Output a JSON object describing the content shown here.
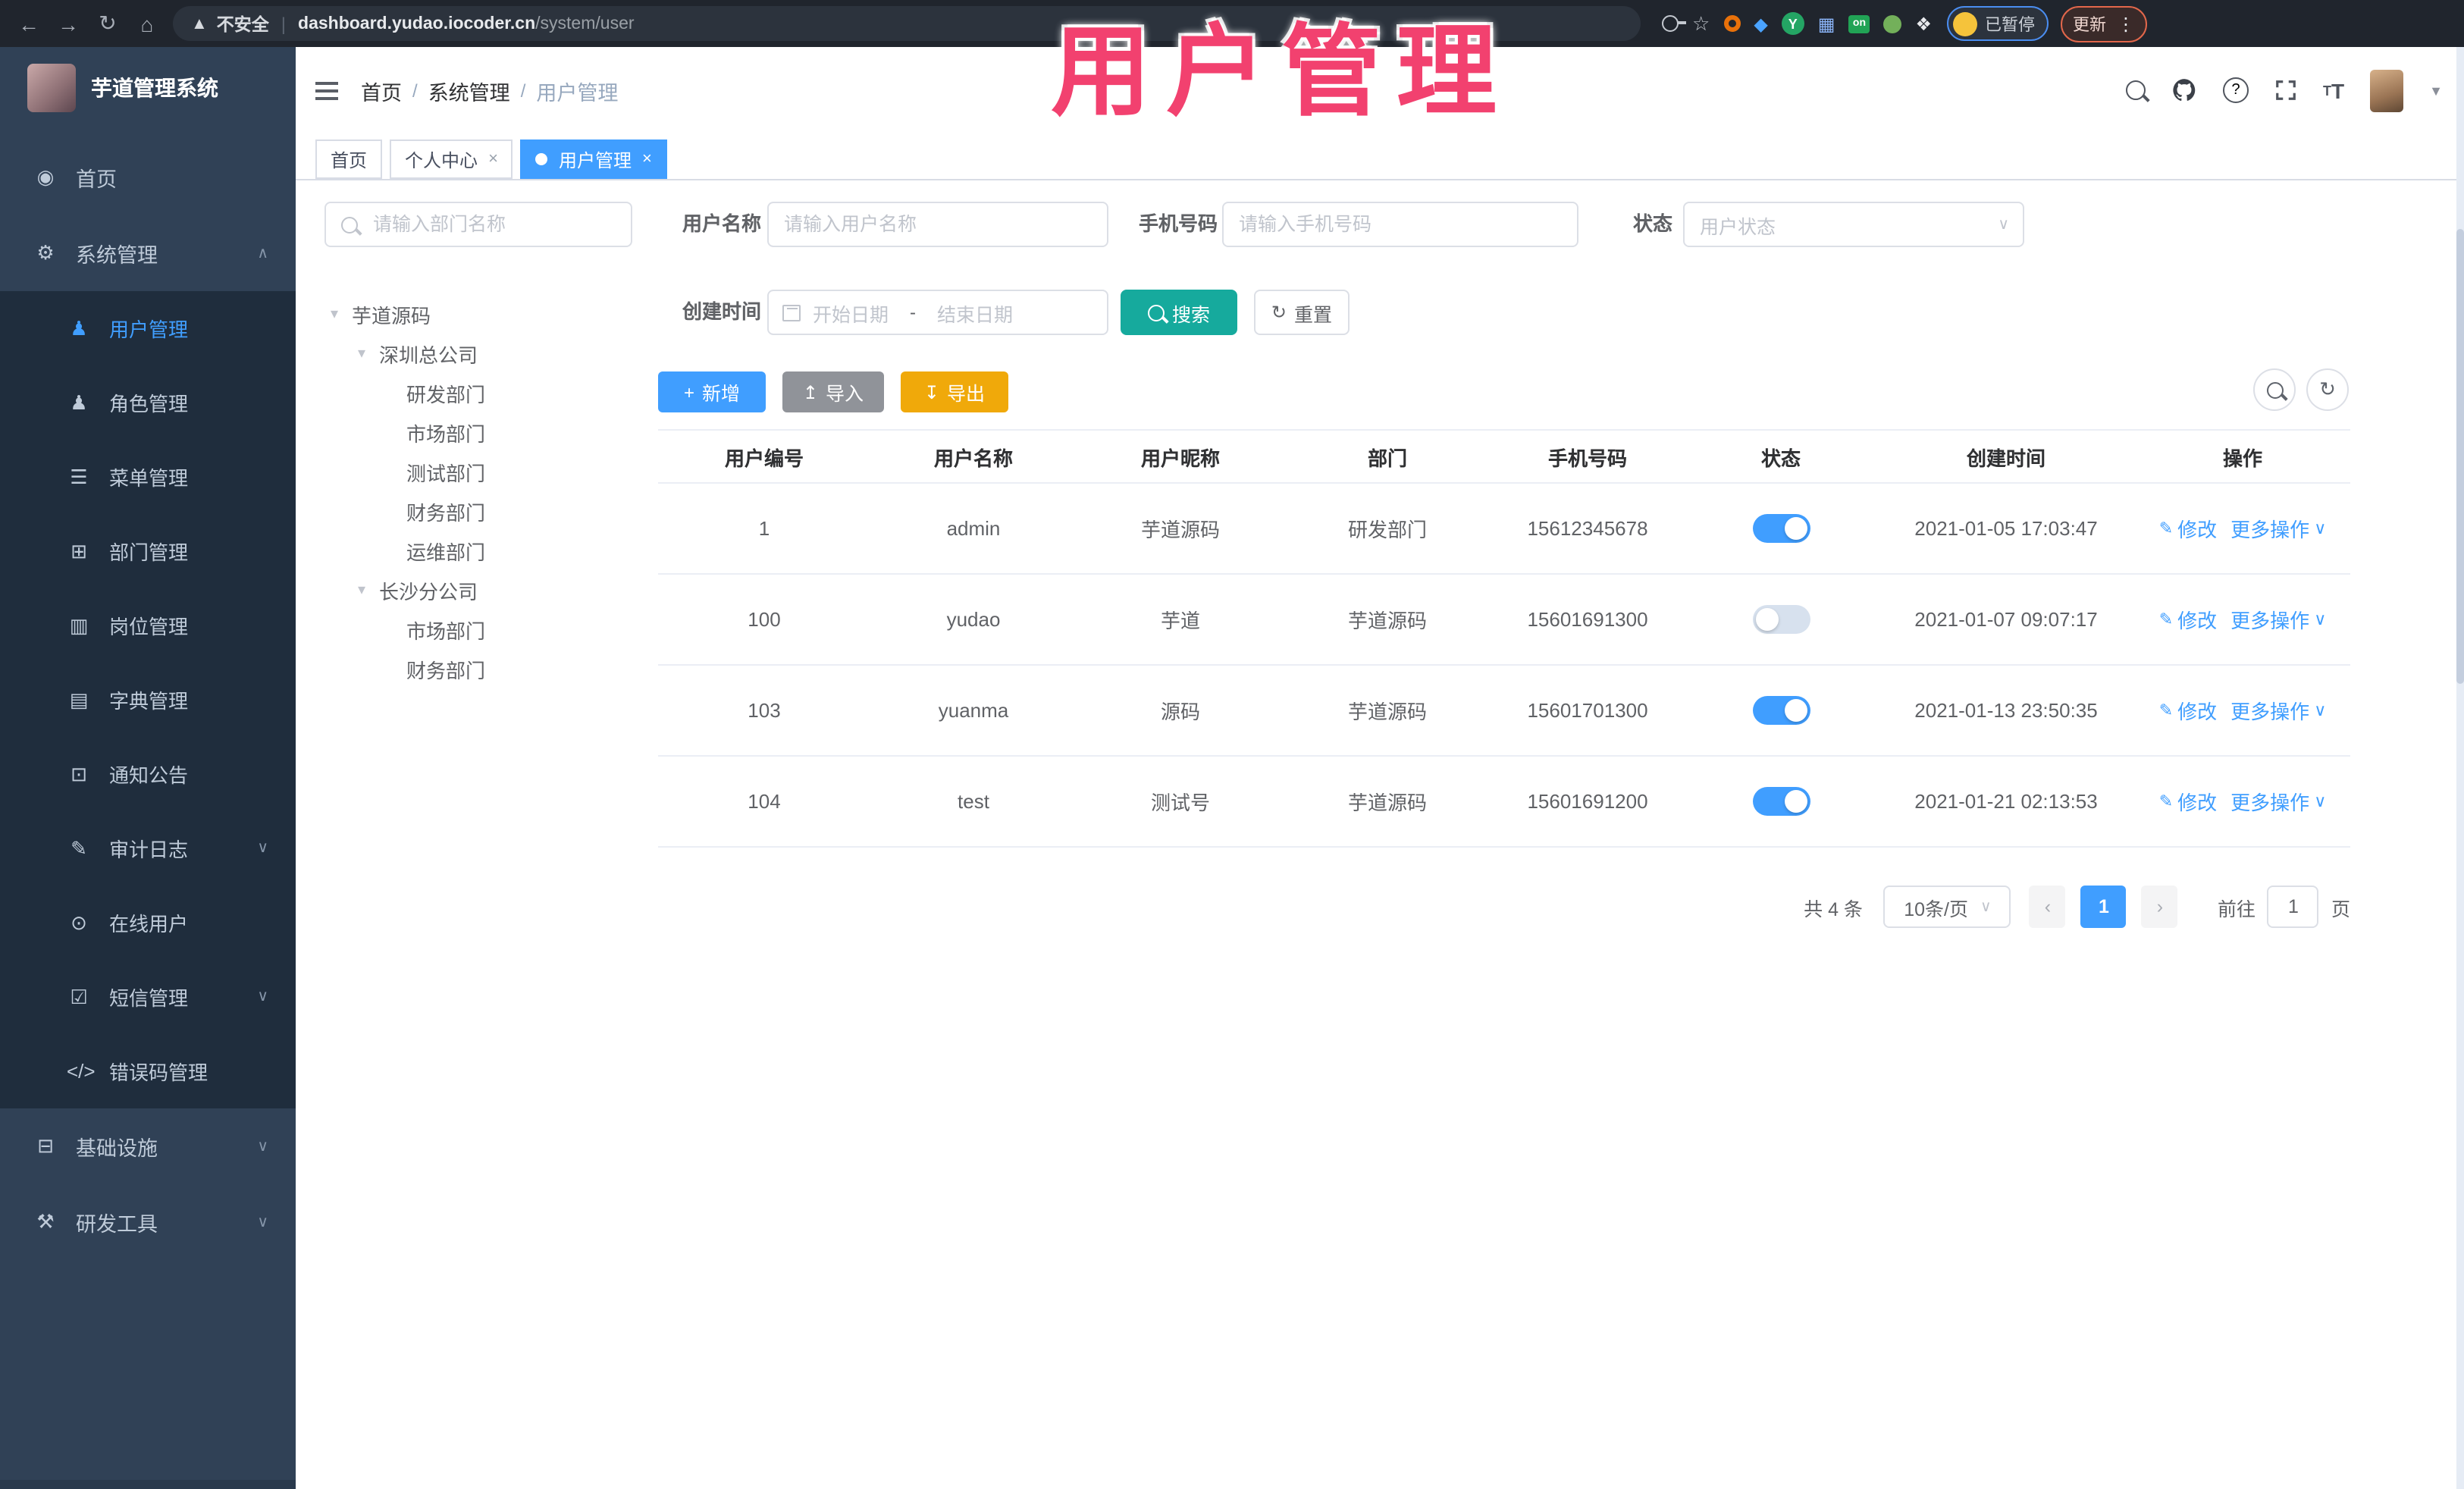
{
  "browser": {
    "security_label": "不安全",
    "url_host": "dashboard.yudao.iocoder.cn",
    "url_path": "/system/user",
    "paused_label": "已暂停",
    "update_label": "更新"
  },
  "overlay": {
    "title": "用户管理"
  },
  "logo": {
    "title": "芋道管理系统"
  },
  "breadcrumb": {
    "items": [
      "首页",
      "系统管理",
      "用户管理"
    ],
    "sep": "/"
  },
  "tabs": {
    "items": [
      {
        "name": "tab-home",
        "label": "首页",
        "cls": ""
      },
      {
        "name": "tab-profile",
        "label": "个人中心",
        "close": "×",
        "cls": ""
      },
      {
        "name": "tab-user-mgmt",
        "label": "用户管理",
        "close": "×",
        "cls": "active"
      }
    ]
  },
  "sidebar": {
    "items": [
      {
        "name": "menu-home",
        "icon": "dashboard-icon",
        "glyph": "◉",
        "label": "首页",
        "cls": "root"
      },
      {
        "name": "menu-system-mgmt",
        "icon": "gear-icon",
        "glyph": "⚙",
        "label": "系统管理",
        "chevron": "∧",
        "cls": "root"
      },
      {
        "name": "menu-user-mgmt",
        "icon": "user-icon",
        "glyph": "♟",
        "label": "用户管理",
        "cls": "sub active"
      },
      {
        "name": "menu-role-mgmt",
        "icon": "users-icon",
        "glyph": "♟",
        "label": "角色管理",
        "cls": "sub"
      },
      {
        "name": "menu-menu-mgmt",
        "icon": "list-icon",
        "glyph": "☰",
        "label": "菜单管理",
        "cls": "sub"
      },
      {
        "name": "menu-dept-mgmt",
        "icon": "org-tree-icon",
        "glyph": "⊞",
        "label": "部门管理",
        "cls": "sub"
      },
      {
        "name": "menu-post-mgmt",
        "icon": "id-card-icon",
        "glyph": "▥",
        "label": "岗位管理",
        "cls": "sub"
      },
      {
        "name": "menu-dict-mgmt",
        "icon": "book-icon",
        "glyph": "▤",
        "label": "字典管理",
        "cls": "sub"
      },
      {
        "name": "menu-notice",
        "icon": "megaphone-icon",
        "glyph": "⊡",
        "label": "通知公告",
        "cls": "sub"
      },
      {
        "name": "menu-audit-log",
        "icon": "edit-icon",
        "glyph": "✎",
        "label": "审计日志",
        "chevron": "∨",
        "cls": "sub"
      },
      {
        "name": "menu-online-users",
        "icon": "broadcast-icon",
        "glyph": "⊙",
        "label": "在线用户",
        "cls": "sub"
      },
      {
        "name": "menu-sms-mgmt",
        "icon": "shield-check-icon",
        "glyph": "☑",
        "label": "短信管理",
        "chevron": "∨",
        "cls": "sub"
      },
      {
        "name": "menu-error-code",
        "icon": "code-icon",
        "glyph": "</>",
        "label": "错误码管理",
        "cls": "sub"
      },
      {
        "name": "menu-infrastructure",
        "icon": "monitor-icon",
        "glyph": "⊟",
        "label": "基础设施",
        "chevron": "∨",
        "cls": "root"
      },
      {
        "name": "menu-dev-tools",
        "icon": "toolbox-icon",
        "glyph": "⚒",
        "label": "研发工具",
        "chevron": "∨",
        "cls": "root"
      }
    ]
  },
  "dept_panel": {
    "search_placeholder": "请输入部门名称",
    "tree": [
      {
        "label": "芋道源码",
        "caret": "▾",
        "cls": "lvl0"
      },
      {
        "label": "深圳总公司",
        "caret": "▾",
        "cls": "lvl1"
      },
      {
        "label": "研发部门",
        "cls": "lvl2"
      },
      {
        "label": "市场部门",
        "cls": "lvl2"
      },
      {
        "label": "测试部门",
        "cls": "lvl2"
      },
      {
        "label": "财务部门",
        "cls": "lvl2"
      },
      {
        "label": "运维部门",
        "cls": "lvl2"
      },
      {
        "label": "长沙分公司",
        "caret": "▾",
        "cls": "lvl1"
      },
      {
        "label": "市场部门",
        "cls": "lvl2"
      },
      {
        "label": "财务部门",
        "cls": "lvl2"
      }
    ]
  },
  "filters": {
    "username": {
      "label": "用户名称",
      "placeholder": "请输入用户名称"
    },
    "mobile": {
      "label": "手机号码",
      "placeholder": "请输入手机号码"
    },
    "status": {
      "label": "状态",
      "placeholder": "用户状态"
    },
    "create_time": {
      "label": "创建时间",
      "start": "开始日期",
      "sep": "-",
      "end": "结束日期"
    },
    "search_label": "搜索",
    "reset_label": "重置"
  },
  "toolbar": {
    "add": {
      "icon": "+",
      "label": "新增"
    },
    "import": {
      "icon": "↥",
      "label": "导入"
    },
    "export": {
      "icon": "↧",
      "label": "导出"
    }
  },
  "icons": {
    "refresh": "↻",
    "edit_pencil": "✎",
    "caret_down": "∨",
    "chevron_down": "∨",
    "dropdown": "▾"
  },
  "table": {
    "columns": [
      "用户编号",
      "用户名称",
      "用户昵称",
      "部门",
      "手机号码",
      "状态",
      "创建时间",
      "操作"
    ],
    "actions": {
      "edit": "修改",
      "more": "更多操作"
    },
    "rows": [
      {
        "id": "1",
        "username": "admin",
        "nickname": "芋道源码",
        "dept": "研发部门",
        "phone": "15612345678",
        "on": true,
        "time": "2021-01-05 17:03:47"
      },
      {
        "id": "100",
        "username": "yudao",
        "nickname": "芋道",
        "dept": "芋道源码",
        "phone": "15601691300",
        "on": false,
        "time": "2021-01-07 09:07:17"
      },
      {
        "id": "103",
        "username": "yuanma",
        "nickname": "源码",
        "dept": "芋道源码",
        "phone": "15601701300",
        "on": true,
        "time": "2021-01-13 23:50:35"
      },
      {
        "id": "104",
        "username": "test",
        "nickname": "测试号",
        "dept": "芋道源码",
        "phone": "15601691200",
        "on": true,
        "time": "2021-01-21 02:13:53"
      }
    ]
  },
  "pagination": {
    "total": "共 4 条",
    "page_size": "10条/页",
    "prev": "‹",
    "page": "1",
    "next": "›",
    "goto": "前往",
    "goto_value": "1",
    "unit": "页"
  }
}
